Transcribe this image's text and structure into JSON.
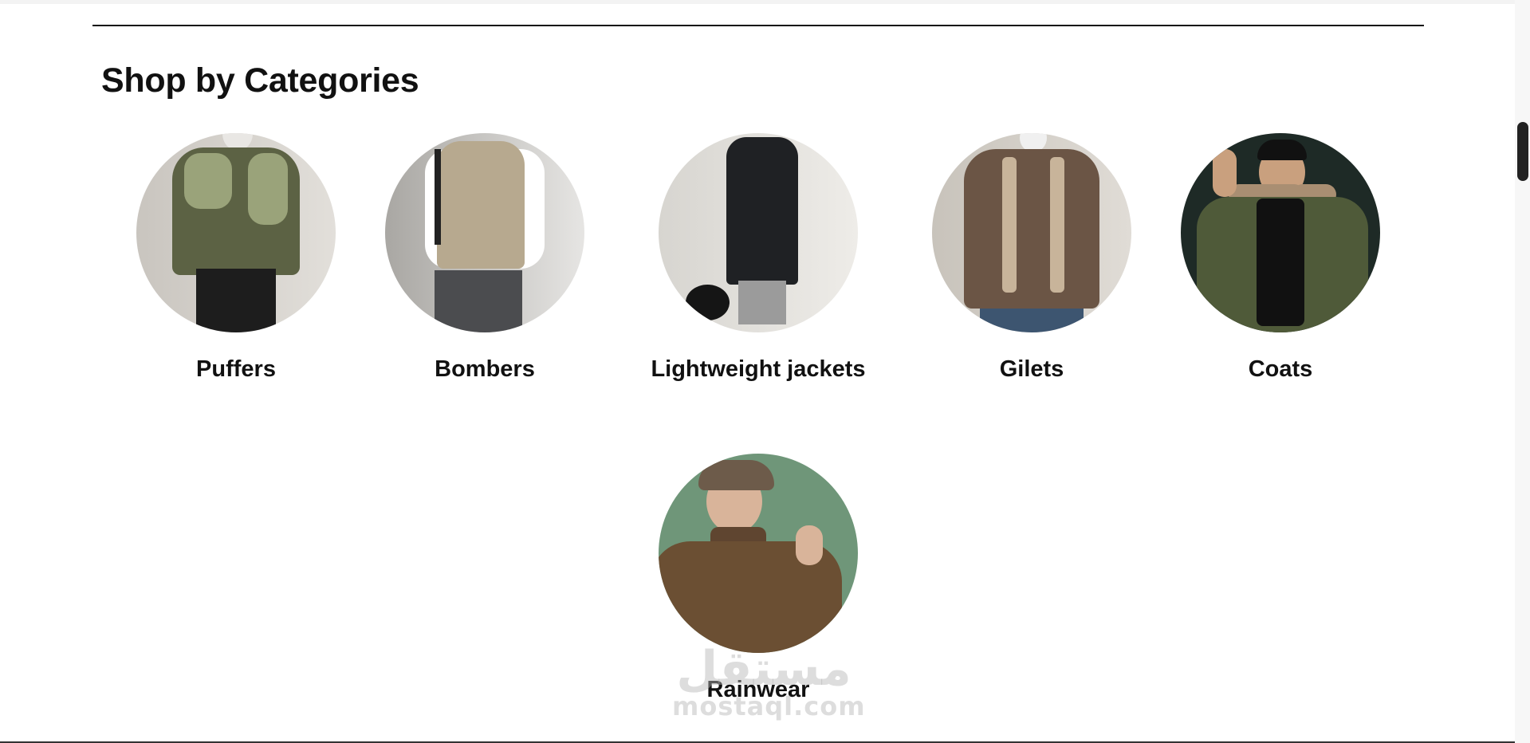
{
  "section": {
    "title": "Shop by Categories"
  },
  "categories": [
    {
      "label": "Puffers",
      "icon": "puffer-jacket-photo",
      "bg": "#cfccc6",
      "garment": "#5c6244",
      "accent": "#9aa37a"
    },
    {
      "label": "Bombers",
      "icon": "knit-vest-photo",
      "bg": "#dad8d4",
      "garment": "#b7a98f",
      "accent": "#ffffff"
    },
    {
      "label": "Lightweight jackets",
      "icon": "trench-coat-photo",
      "bg": "#e5e3df",
      "garment": "#1f2124",
      "accent": "#9b9b9b"
    },
    {
      "label": "Gilets",
      "icon": "track-jacket-photo",
      "bg": "#d6d2cc",
      "garment": "#6b5545",
      "accent": "#c8b49a"
    },
    {
      "label": "Coats",
      "icon": "parka-photo",
      "bg": "#1e2a26",
      "garment": "#4f5a39",
      "accent": "#a98e72"
    },
    {
      "label": "Rainwear",
      "icon": "turtleneck-sweater-photo",
      "bg": "#6f9679",
      "garment": "#6b4f33",
      "accent": "#d9b49a"
    }
  ],
  "watermark": {
    "arabic": "مستقل",
    "latin": "mostaql.com"
  },
  "colors": {
    "text": "#111111",
    "background": "#ffffff",
    "rule": "#111111"
  }
}
